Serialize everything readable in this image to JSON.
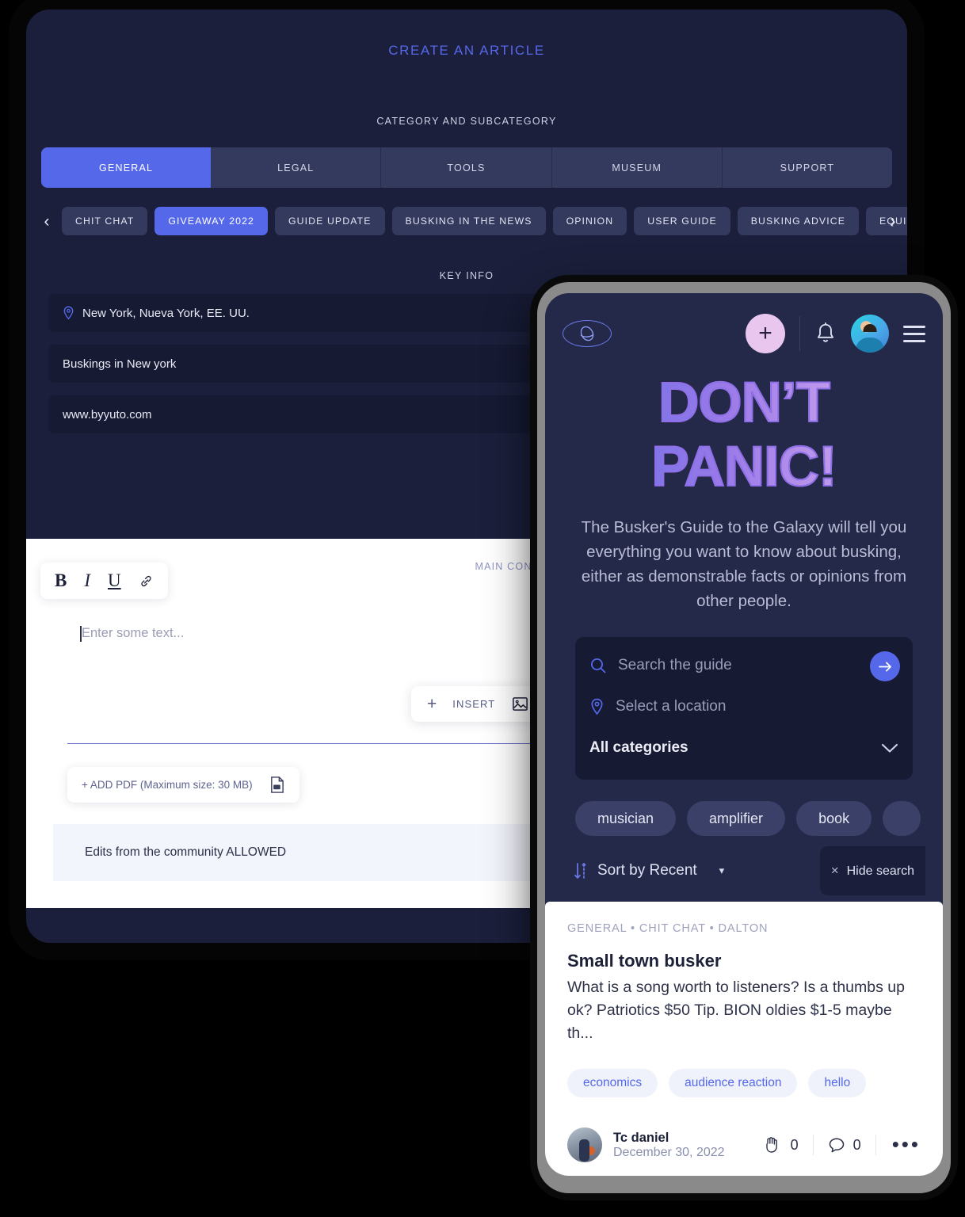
{
  "tablet": {
    "page_title": "CREATE AN ARTICLE",
    "category_section_label": "CATEGORY AND SUBCATEGORY",
    "category_tabs": [
      {
        "label": "GENERAL",
        "active": true
      },
      {
        "label": "LEGAL",
        "active": false
      },
      {
        "label": "TOOLS",
        "active": false
      },
      {
        "label": "MUSEUM",
        "active": false
      },
      {
        "label": "SUPPORT",
        "active": false
      }
    ],
    "subcategory_prev": "‹",
    "subcategory_next": "›",
    "subcategories": [
      {
        "label": "CHIT CHAT",
        "active": false
      },
      {
        "label": "GIVEAWAY 2022",
        "active": true
      },
      {
        "label": "GUIDE UPDATE",
        "active": false
      },
      {
        "label": "BUSKING IN THE NEWS",
        "active": false
      },
      {
        "label": "OPINION",
        "active": false
      },
      {
        "label": "USER GUIDE",
        "active": false
      },
      {
        "label": "BUSKING ADVICE",
        "active": false
      },
      {
        "label": "EQUIPMENT",
        "active": false
      }
    ],
    "key_info_label": "KEY INFO",
    "fields": {
      "location_value": "New York, Nueva York, EE. UU.",
      "title_value": "Buskings in New york",
      "website_value": "www.byyuto.com"
    },
    "editor": {
      "main_content_label": "MAIN CONTENT",
      "format_bold": "B",
      "format_italic": "I",
      "format_underline": "U",
      "body_placeholder": "Enter some text...",
      "insert_plus": "+",
      "insert_label": "INSERT",
      "add_pdf_label": "+ ADD PDF (Maximum size: 30 MB)",
      "community_edits_label": "Edits from the community ALLOWED"
    }
  },
  "phone": {
    "nav": {
      "add_label": "+",
      "logo_name": "galaxy-logo"
    },
    "hero_title": "DON’T PANIC!",
    "hero_subtitle": "The Busker's Guide to the Galaxy will tell you everything you want to know about busking, either as demonstrable facts or opinions from other people.",
    "search": {
      "query_placeholder": "Search the guide",
      "location_placeholder": "Select a location",
      "category_value": "All categories",
      "chevron": "⌄"
    },
    "tags": [
      {
        "label": "musician"
      },
      {
        "label": "amplifier"
      },
      {
        "label": "book"
      }
    ],
    "tag_next": "›",
    "sort": {
      "label": "Sort by Recent",
      "caret": "▾",
      "hide_close": "×",
      "hide_label": "Hide search"
    },
    "result": {
      "breadcrumb": "GENERAL • CHIT CHAT • DALTON",
      "title": "Small town busker",
      "excerpt": "What is a song worth to listeners? Is a thumbs up ok? Patriotics $50 Tip. BION oldies $1-5 maybe th...",
      "tags": [
        {
          "label": "economics"
        },
        {
          "label": "audience reaction"
        },
        {
          "label": "hello"
        }
      ],
      "author": "Tc daniel",
      "date": "December 30, 2022",
      "applause_count": "0",
      "comment_count": "0",
      "more": "•••"
    }
  },
  "colors": {
    "accent_blue": "#5568ea",
    "tablet_bg": "#1b1f3b",
    "phone_bg": "#242849",
    "field_bg": "#161a33",
    "chip_bg": "#343a5e",
    "pink_fab": "#e8c6ee"
  }
}
